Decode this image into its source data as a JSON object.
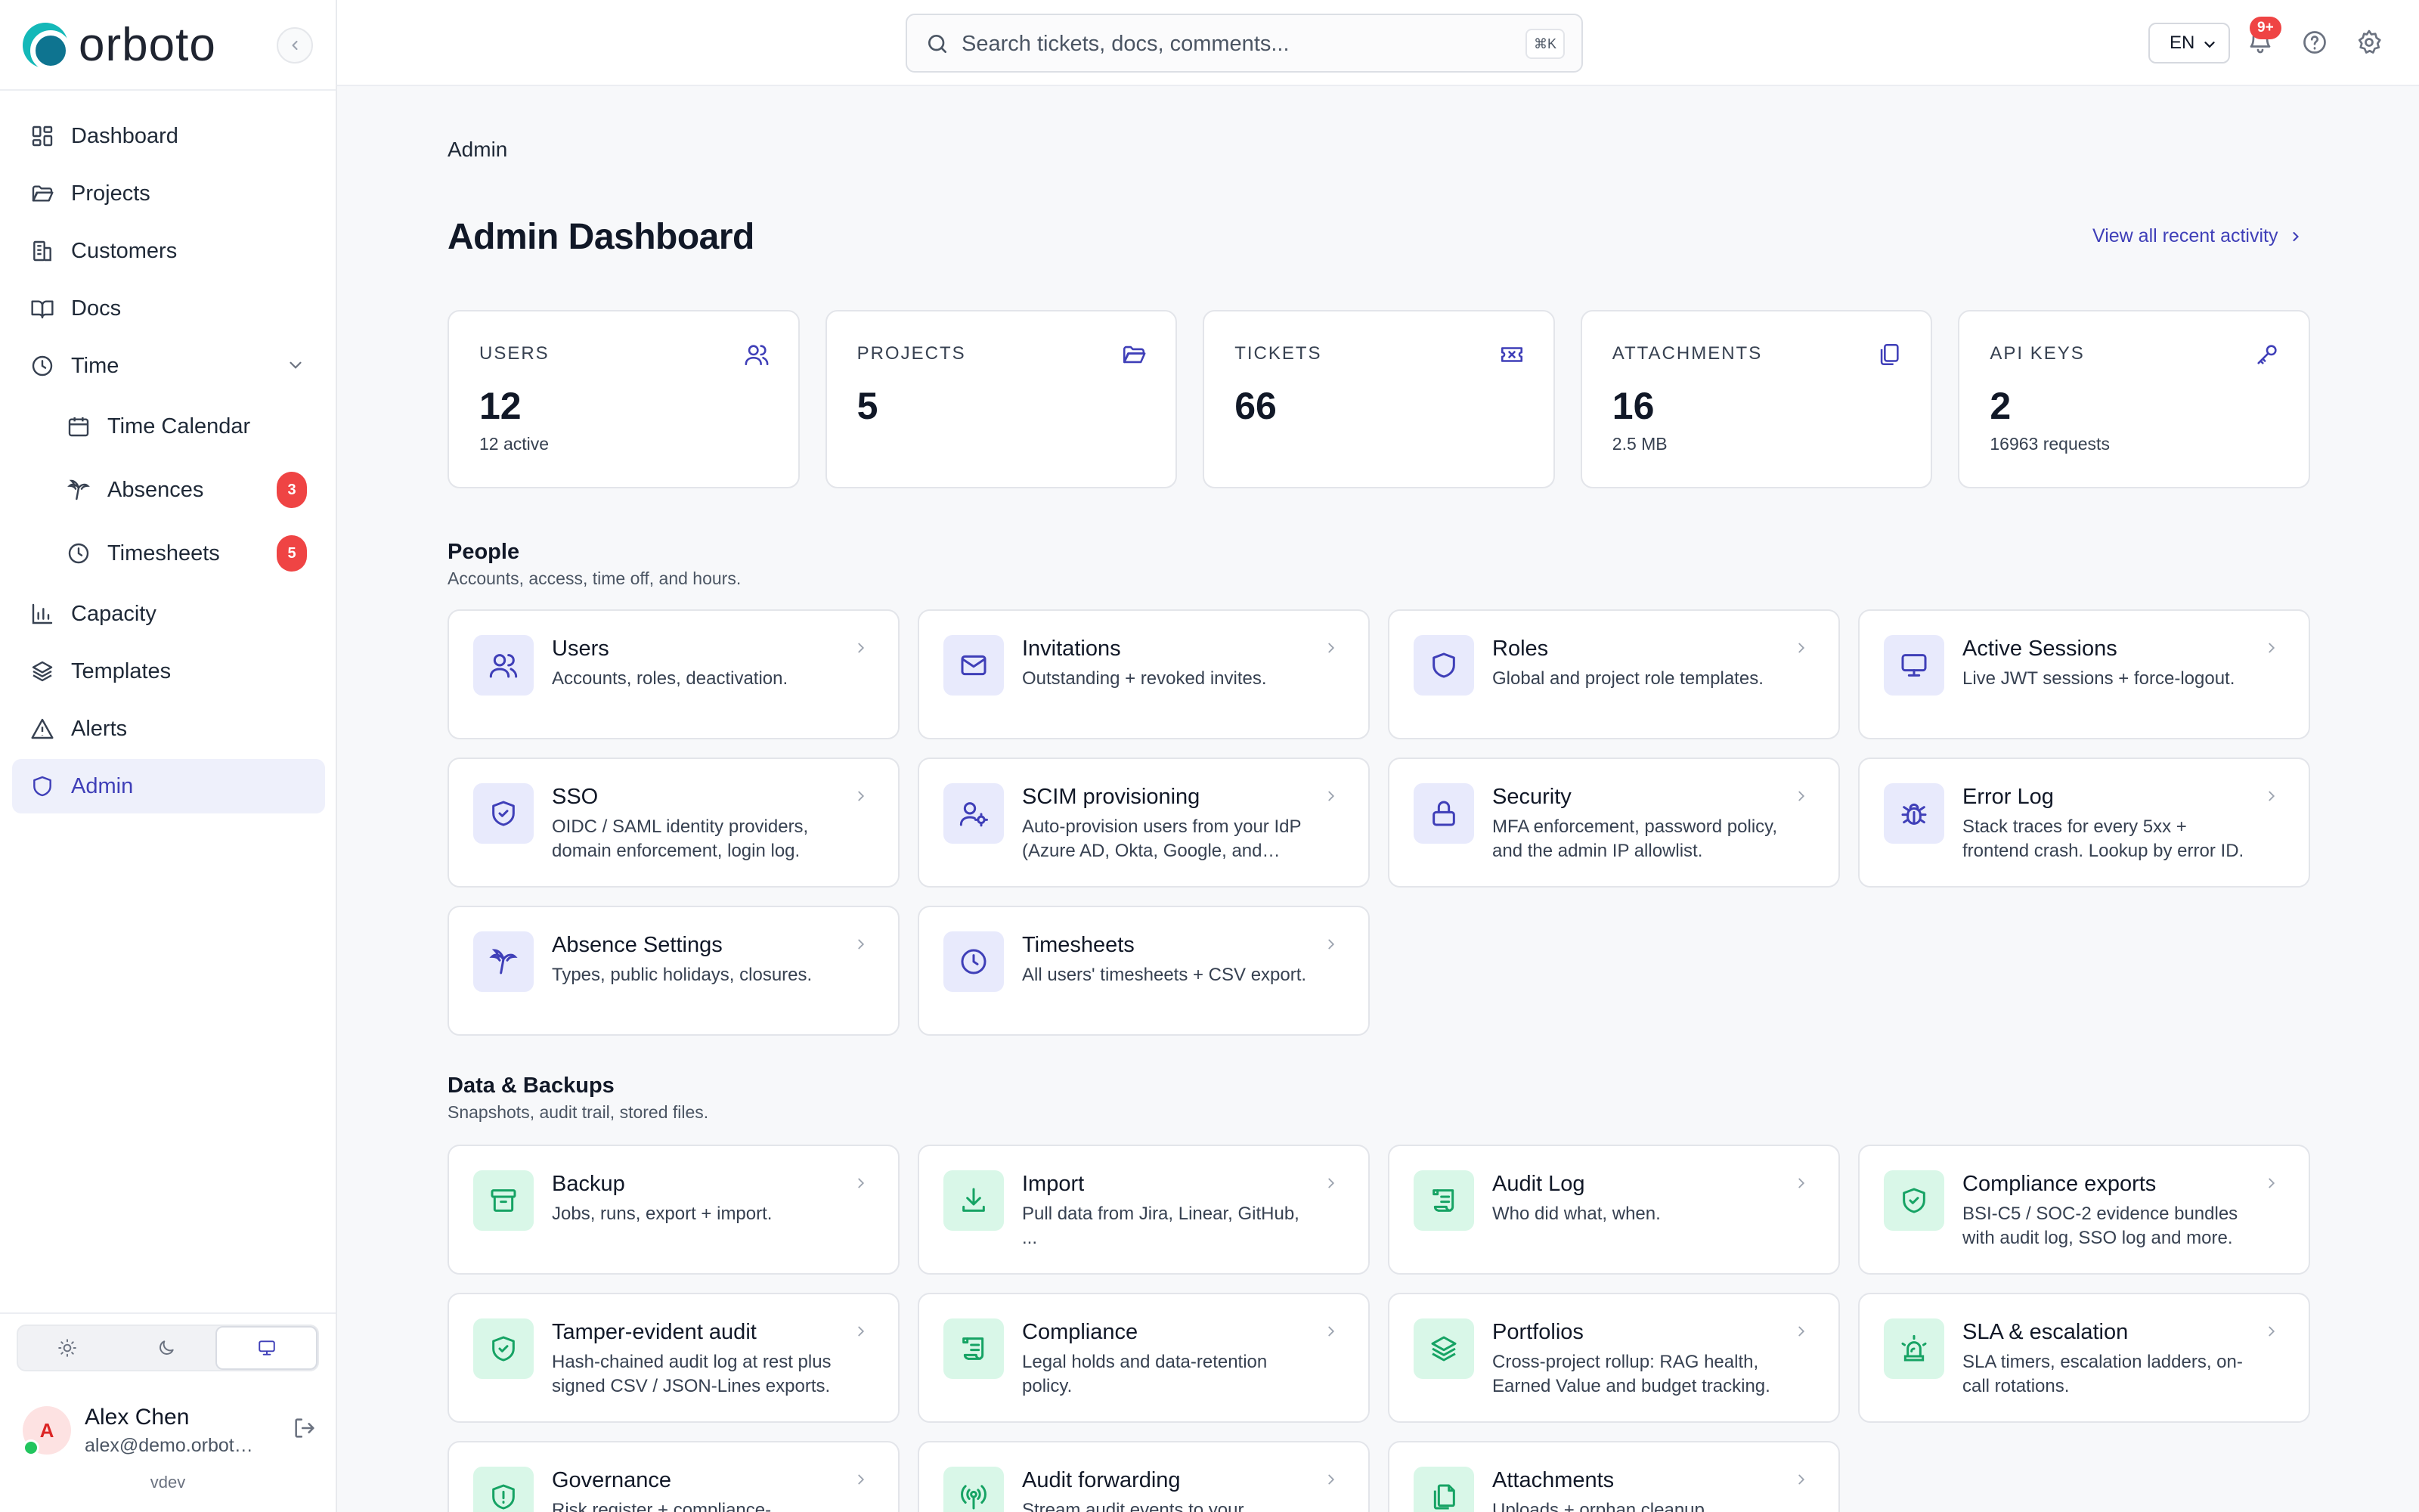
{
  "brand": {
    "name": "orboto"
  },
  "sidebar": {
    "items": [
      {
        "label": "Dashboard",
        "icon": "dashboard-icon"
      },
      {
        "label": "Projects",
        "icon": "folder-icon"
      },
      {
        "label": "Customers",
        "icon": "building-icon"
      },
      {
        "label": "Docs",
        "icon": "book-icon"
      },
      {
        "label": "Time",
        "icon": "clock-icon"
      },
      {
        "label": "Time Calendar",
        "icon": "calendar-icon"
      },
      {
        "label": "Absences",
        "icon": "palm-tree-icon",
        "badge": "3"
      },
      {
        "label": "Timesheets",
        "icon": "clock-icon",
        "badge": "5"
      },
      {
        "label": "Capacity",
        "icon": "bar-chart-icon"
      },
      {
        "label": "Templates",
        "icon": "layers-icon"
      },
      {
        "label": "Alerts",
        "icon": "alert-triangle-icon"
      },
      {
        "label": "Admin",
        "icon": "shield-icon"
      }
    ],
    "user": {
      "initial": "A",
      "name": "Alex Chen",
      "email": "alex@demo.orboto.io"
    },
    "version": "vdev"
  },
  "topbar": {
    "search_placeholder": "Search tickets, docs, comments...",
    "search_shortcut": "⌘K",
    "language": "EN",
    "notification_badge": "9+"
  },
  "main": {
    "breadcrumb": "Admin",
    "title": "Admin Dashboard",
    "view_all": "View all recent activity",
    "stats": [
      {
        "label": "USERS",
        "value": "12",
        "sub": "12 active",
        "icon": "users-icon"
      },
      {
        "label": "PROJECTS",
        "value": "5",
        "sub": "",
        "icon": "folder-icon"
      },
      {
        "label": "TICKETS",
        "value": "66",
        "sub": "",
        "icon": "ticket-icon"
      },
      {
        "label": "ATTACHMENTS",
        "value": "16",
        "sub": "2.5 MB",
        "icon": "copy-icon"
      },
      {
        "label": "API KEYS",
        "value": "2",
        "sub": "16963 requests",
        "icon": "key-icon"
      }
    ],
    "sections": [
      {
        "title": "People",
        "subtitle": "Accounts, access, time off, and hours.",
        "cards": [
          {
            "title": "Users",
            "desc": "Accounts, roles, deactivation.",
            "icon": "users-icon"
          },
          {
            "title": "Invitations",
            "desc": "Outstanding + revoked invites.",
            "icon": "mail-icon"
          },
          {
            "title": "Roles",
            "desc": "Global and project role templates.",
            "icon": "shield-icon"
          },
          {
            "title": "Active Sessions",
            "desc": "Live JWT sessions + force-logout.",
            "icon": "monitor-icon"
          },
          {
            "title": "SSO",
            "desc": "OIDC / SAML identity providers, domain enforcement, login log.",
            "icon": "shield-check-icon"
          },
          {
            "title": "SCIM provisioning",
            "desc": "Auto-provision users from your IdP (Azure AD, Okta, Google, and more).",
            "icon": "user-cog-icon"
          },
          {
            "title": "Security",
            "desc": "MFA enforcement, password policy, and the admin IP allowlist.",
            "icon": "lock-icon"
          },
          {
            "title": "Error Log",
            "desc": "Stack traces for every 5xx + frontend crash. Lookup by error ID.",
            "icon": "bug-icon"
          },
          {
            "title": "Absence Settings",
            "desc": "Types, public holidays, closures.",
            "icon": "palm-tree-icon"
          },
          {
            "title": "Timesheets",
            "desc": "All users' timesheets + CSV export.",
            "icon": "clock-icon"
          }
        ]
      },
      {
        "title": "Data & Backups",
        "subtitle": "Snapshots, audit trail, stored files.",
        "cards": [
          {
            "title": "Backup",
            "desc": "Jobs, runs, export + import.",
            "icon": "archive-icon"
          },
          {
            "title": "Import",
            "desc": "Pull data from Jira, Linear, GitHub, ...",
            "icon": "download-icon"
          },
          {
            "title": "Audit Log",
            "desc": "Who did what, when.",
            "icon": "scroll-icon"
          },
          {
            "title": "Compliance exports",
            "desc": "BSI-C5 / SOC-2 evidence bundles with audit log, SSO log and more.",
            "icon": "shield-check-icon"
          },
          {
            "title": "Tamper-evident audit",
            "desc": "Hash-chained audit log at rest plus signed CSV / JSON-Lines exports.",
            "icon": "shield-check-icon"
          },
          {
            "title": "Compliance",
            "desc": "Legal holds and data-retention policy.",
            "icon": "scroll-icon"
          },
          {
            "title": "Portfolios",
            "desc": "Cross-project rollup: RAG health, Earned Value and budget tracking.",
            "icon": "layers-icon"
          },
          {
            "title": "SLA & escalation",
            "desc": "SLA timers, escalation ladders, on-call rotations.",
            "icon": "siren-icon"
          },
          {
            "title": "Governance",
            "desc": "Risk register + compliance-",
            "icon": "shield-alert-icon"
          },
          {
            "title": "Audit forwarding",
            "desc": "Stream audit events to your",
            "icon": "broadcast-icon"
          },
          {
            "title": "Attachments",
            "desc": "Uploads + orphan cleanup.",
            "icon": "files-icon"
          }
        ]
      }
    ]
  },
  "colors": {
    "accent": "#3f3fb8",
    "accent_bg": "#eef0fb",
    "green": "#16a364",
    "green_bg": "#d9f7e8",
    "badge": "#ef4444"
  }
}
